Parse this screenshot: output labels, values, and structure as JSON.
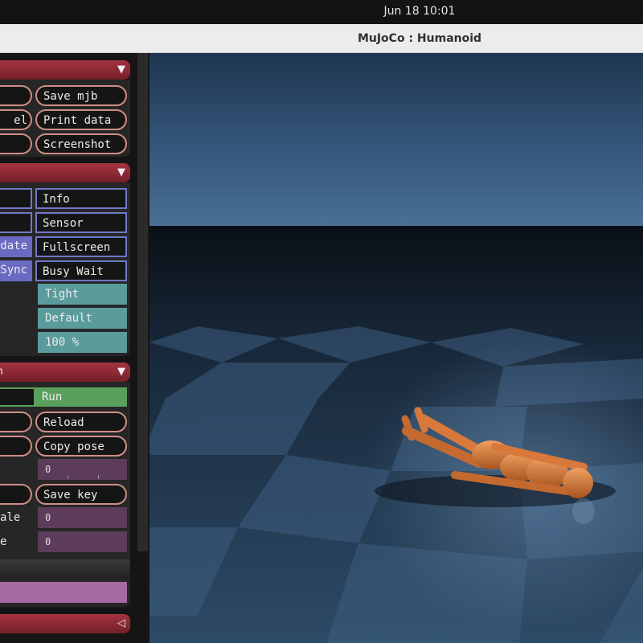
{
  "system": {
    "clock": "Jun 18  10:01"
  },
  "window": {
    "title": "MuJoCo : Humanoid"
  },
  "file_section": {
    "collapse_arrow": "▼",
    "buttons": [
      "Save mjb",
      "el",
      "Print data",
      "Screenshot"
    ]
  },
  "option_section": {
    "collapse_arrow": "▼",
    "checkboxes_right": [
      "Info",
      "Sensor",
      "Fullscreen",
      "Busy Wait"
    ],
    "checkboxes_left": [
      "date",
      "Sync"
    ],
    "selects": [
      "Tight",
      "Default",
      "100 %"
    ]
  },
  "simulation_section": {
    "label": "n",
    "collapse_arrow": "▼",
    "run_label": "Run",
    "reload_label": "Reload",
    "copy_pose_label": "Copy pose",
    "key_value": "0",
    "save_key_label": "Save key",
    "noise_scale_label": "ale",
    "noise_scale_value": "0",
    "noise_rate_label": "e",
    "noise_rate_value": "0"
  },
  "watch_section": {
    "collapse_arrow": "◁"
  },
  "colors": {
    "section_header": "#8c2a35",
    "pill_border": "#cf8f86",
    "checkbox_border": "#7078c8",
    "checkbox_on": "#6a6ac2",
    "select_bg": "#5a9b9c",
    "run_green": "#5aa05c",
    "slider_bg": "#5c3c5a",
    "floor_blue": "#2d4a66",
    "humanoid": "#d8783a"
  }
}
